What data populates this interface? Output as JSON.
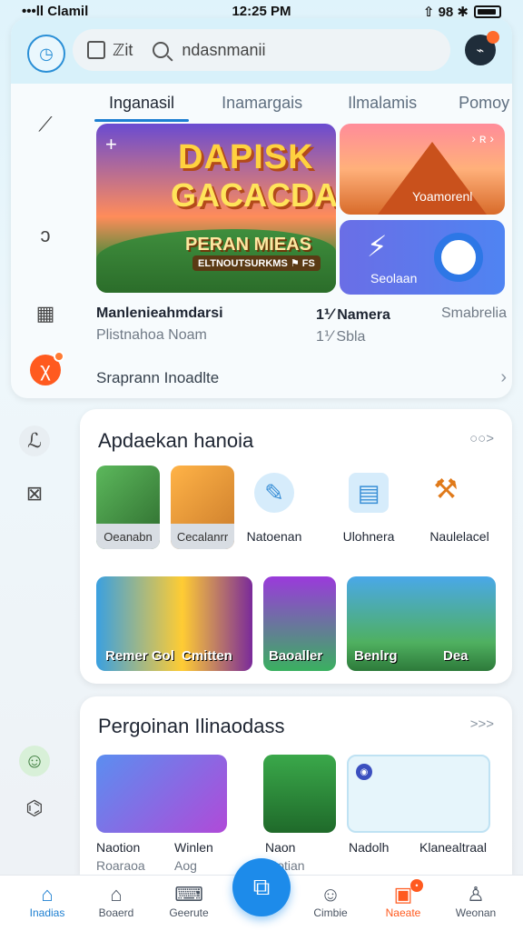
{
  "status_bar": {
    "left": "•••ll Clamil",
    "time": "12:25 PM",
    "right": "⇧ 98 ✱"
  },
  "header": {
    "search_prefix": "ℤit",
    "search_value": "ndasnmanii"
  },
  "tabs": [
    "Inganasil",
    "Inamargais",
    "Ilmalamis",
    "Pomoy"
  ],
  "banner": {
    "title_line1": "DAPISK",
    "title_line2": "GACACDA!",
    "subtitle": "PERAN MIEAS",
    "subbadge": "ELTNOUTSURKMS ⚑ FS",
    "right_top_label": "Yoamorenl",
    "right_bottom_label": "Seolaan"
  },
  "info": {
    "row1": [
      "Manlenieahmdarsi",
      "1⅟ Namera",
      "Smabrelia"
    ],
    "row2": [
      "Plistnahoa Noam",
      "1⅟ Sbla",
      ""
    ]
  },
  "link_row": "Sraprann Inoadlte",
  "section1": {
    "title": "Apdaekan hanoia",
    "more": "○○>",
    "items": [
      {
        "label": "Oeanabn"
      },
      {
        "label": "Cecalanrr"
      },
      {
        "label": "Natoenan"
      },
      {
        "label": "Ulohnera"
      },
      {
        "label": "Naulelacel"
      }
    ],
    "games": [
      {
        "label": "Remer Gol"
      },
      {
        "label": "Cmitten"
      },
      {
        "label": "Baoaller"
      },
      {
        "label": "Benlrg"
      },
      {
        "label": "Dea"
      }
    ]
  },
  "section2": {
    "title": "Pergoinan Ilinaodass",
    "more": ">>>",
    "items": [
      {
        "line1": "Naotion",
        "line2": "Roaraoa"
      },
      {
        "line1": "Winlen",
        "line2": "Aog"
      },
      {
        "line1": "Naon",
        "line2": "Ptotian"
      },
      {
        "line1": "Nadolh",
        "line2": ""
      },
      {
        "line1": "Klanealtraal",
        "line2": ""
      }
    ]
  },
  "bottom_nav": [
    {
      "label": "Inadias"
    },
    {
      "label": "Boaerd"
    },
    {
      "label": "Geerute"
    },
    {
      "label": "Cimbie"
    },
    {
      "label": "Naeate"
    },
    {
      "label": "Weonan"
    }
  ],
  "colors": {
    "accent": "#1d7fd1",
    "orange": "#ff5a1f"
  }
}
